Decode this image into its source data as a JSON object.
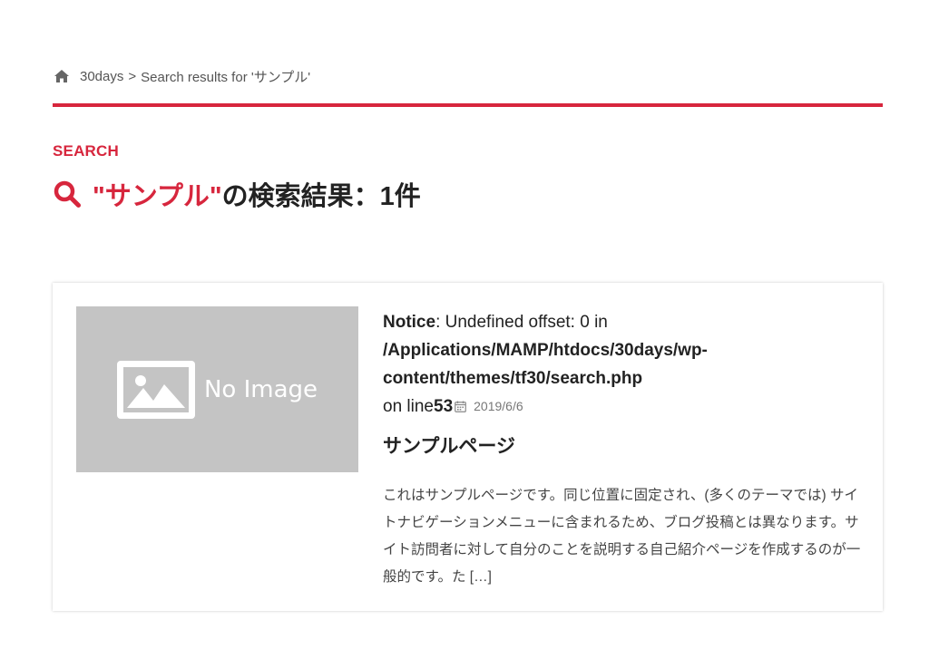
{
  "breadcrumb": {
    "home": "30days",
    "separator": ">",
    "current": "Search results for 'サンプル'"
  },
  "section_label": "SEARCH",
  "heading": {
    "query": "\"サンプル\"",
    "suffix": "の検索結果：1件"
  },
  "result": {
    "thumbnail_text": "No Image",
    "notice_label": "Notice",
    "notice_message": ": Undefined offset: 0 in",
    "notice_path": "/Applications/MAMP/htdocs/30days/wp-content/themes/tf30/search.php",
    "notice_on_line": "on line",
    "notice_line_number": "53",
    "date": "2019/6/6",
    "title": "サンプルページ",
    "excerpt": "これはサンプルページです。同じ位置に固定され、(多くのテーマでは) サイトナビゲーションメニューに含まれるため、ブログ投稿とは異なります。サイト訪問者に対して自分のことを説明する自己紹介ページを作成するのが一般的です。た [&hellip;]"
  },
  "colors": {
    "accent": "#d7263d",
    "thumbnail_bg": "#c4c4c4"
  }
}
